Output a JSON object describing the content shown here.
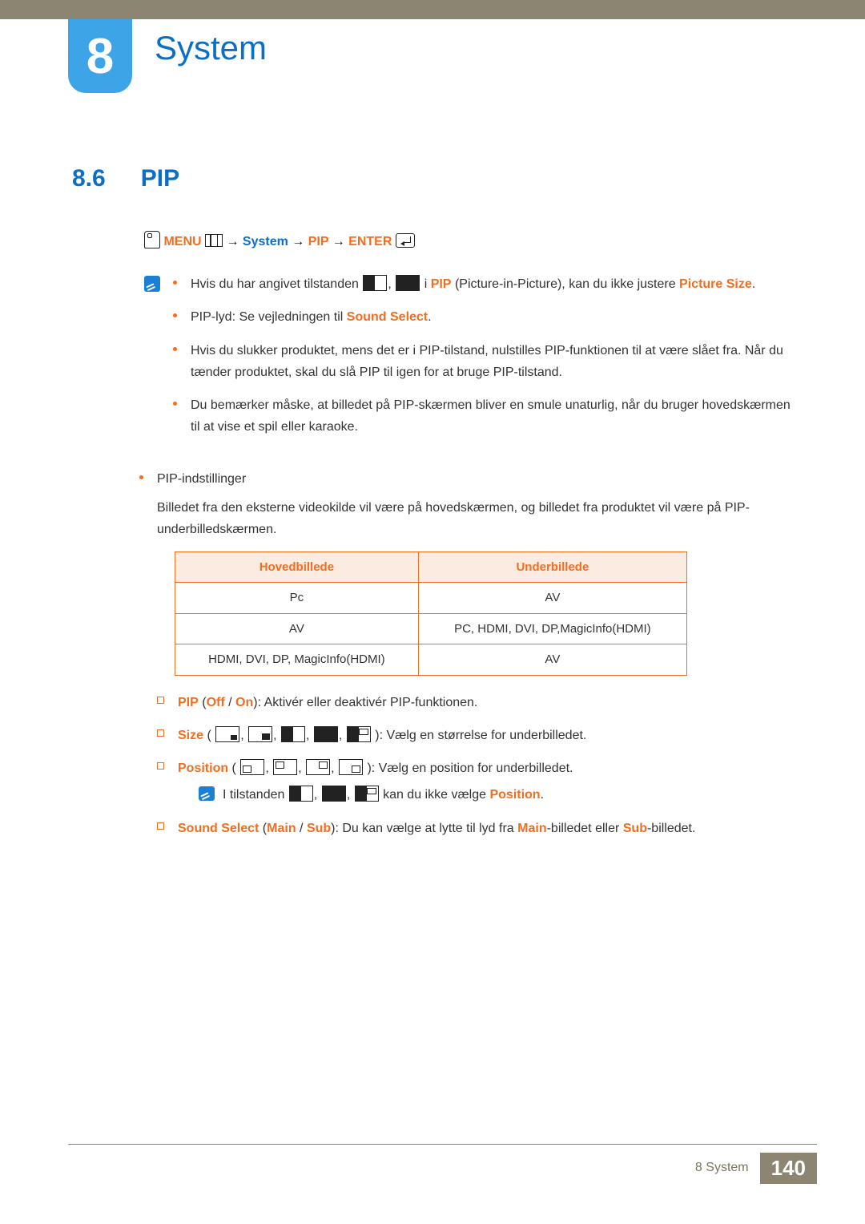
{
  "chapter": {
    "number": "8",
    "title": "System"
  },
  "section": {
    "number": "8.6",
    "title": "PIP"
  },
  "nav": {
    "menu": "MENU",
    "system": "System",
    "pip": "PIP",
    "enter": "ENTER",
    "arrow": " → "
  },
  "notes": {
    "n1a": "Hvis du har angivet tilstanden ",
    "n1b": " i ",
    "n1c": "PIP",
    "n1d": " (Picture-in-Picture), kan du ikke justere ",
    "n1e": "Picture Size",
    "n1f": ".",
    "n2a": "PIP-lyd: Se vejledningen til ",
    "n2b": "Sound Select",
    "n2c": ".",
    "n3": "Hvis du slukker produktet, mens det er i PIP-tilstand, nulstilles PIP-funktionen til at være slået fra. Når du tænder produktet, skal du slå PIP til igen for at bruge PIP-tilstand.",
    "n4": "Du bemærker måske, at billedet på PIP-skærmen bliver en smule unaturlig, når du bruger hovedskærmen til at vise et spil eller karaoke."
  },
  "settings": {
    "title": "PIP-indstillinger",
    "desc": "Billedet fra den eksterne videokilde vil være på hovedskærmen, og billedet fra produktet vil være på PIP-underbilledskærmen."
  },
  "table": {
    "h1": "Hovedbillede",
    "h2": "Underbillede",
    "rows": [
      {
        "c1": "Pc",
        "c2": "AV"
      },
      {
        "c1": "AV",
        "c2": "PC, HDMI, DVI, DP,MagicInfo(HDMI)"
      },
      {
        "c1": "HDMI, DVI, DP, MagicInfo(HDMI)",
        "c2": "AV"
      }
    ]
  },
  "opts": {
    "pip": {
      "k": "PIP",
      "off": "Off",
      "on": "On",
      "t": ": Aktivér eller deaktivér PIP-funktionen."
    },
    "size": {
      "k": "Size",
      "t": ": Vælg en størrelse for underbilledet."
    },
    "pos": {
      "k": "Position",
      "t": ": Vælg en position for underbilledet."
    },
    "posnote": {
      "a": "I tilstanden ",
      "b": " kan du ikke vælge ",
      "c": "Position",
      "d": "."
    },
    "sound": {
      "k": "Sound Select",
      "main": "Main",
      "sub": "Sub",
      "t1": ": Du kan vælge at lytte til lyd fra ",
      "t2": "-billedet eller ",
      "t3": "-billedet."
    }
  },
  "footer": {
    "text": "8 System",
    "page": "140"
  }
}
